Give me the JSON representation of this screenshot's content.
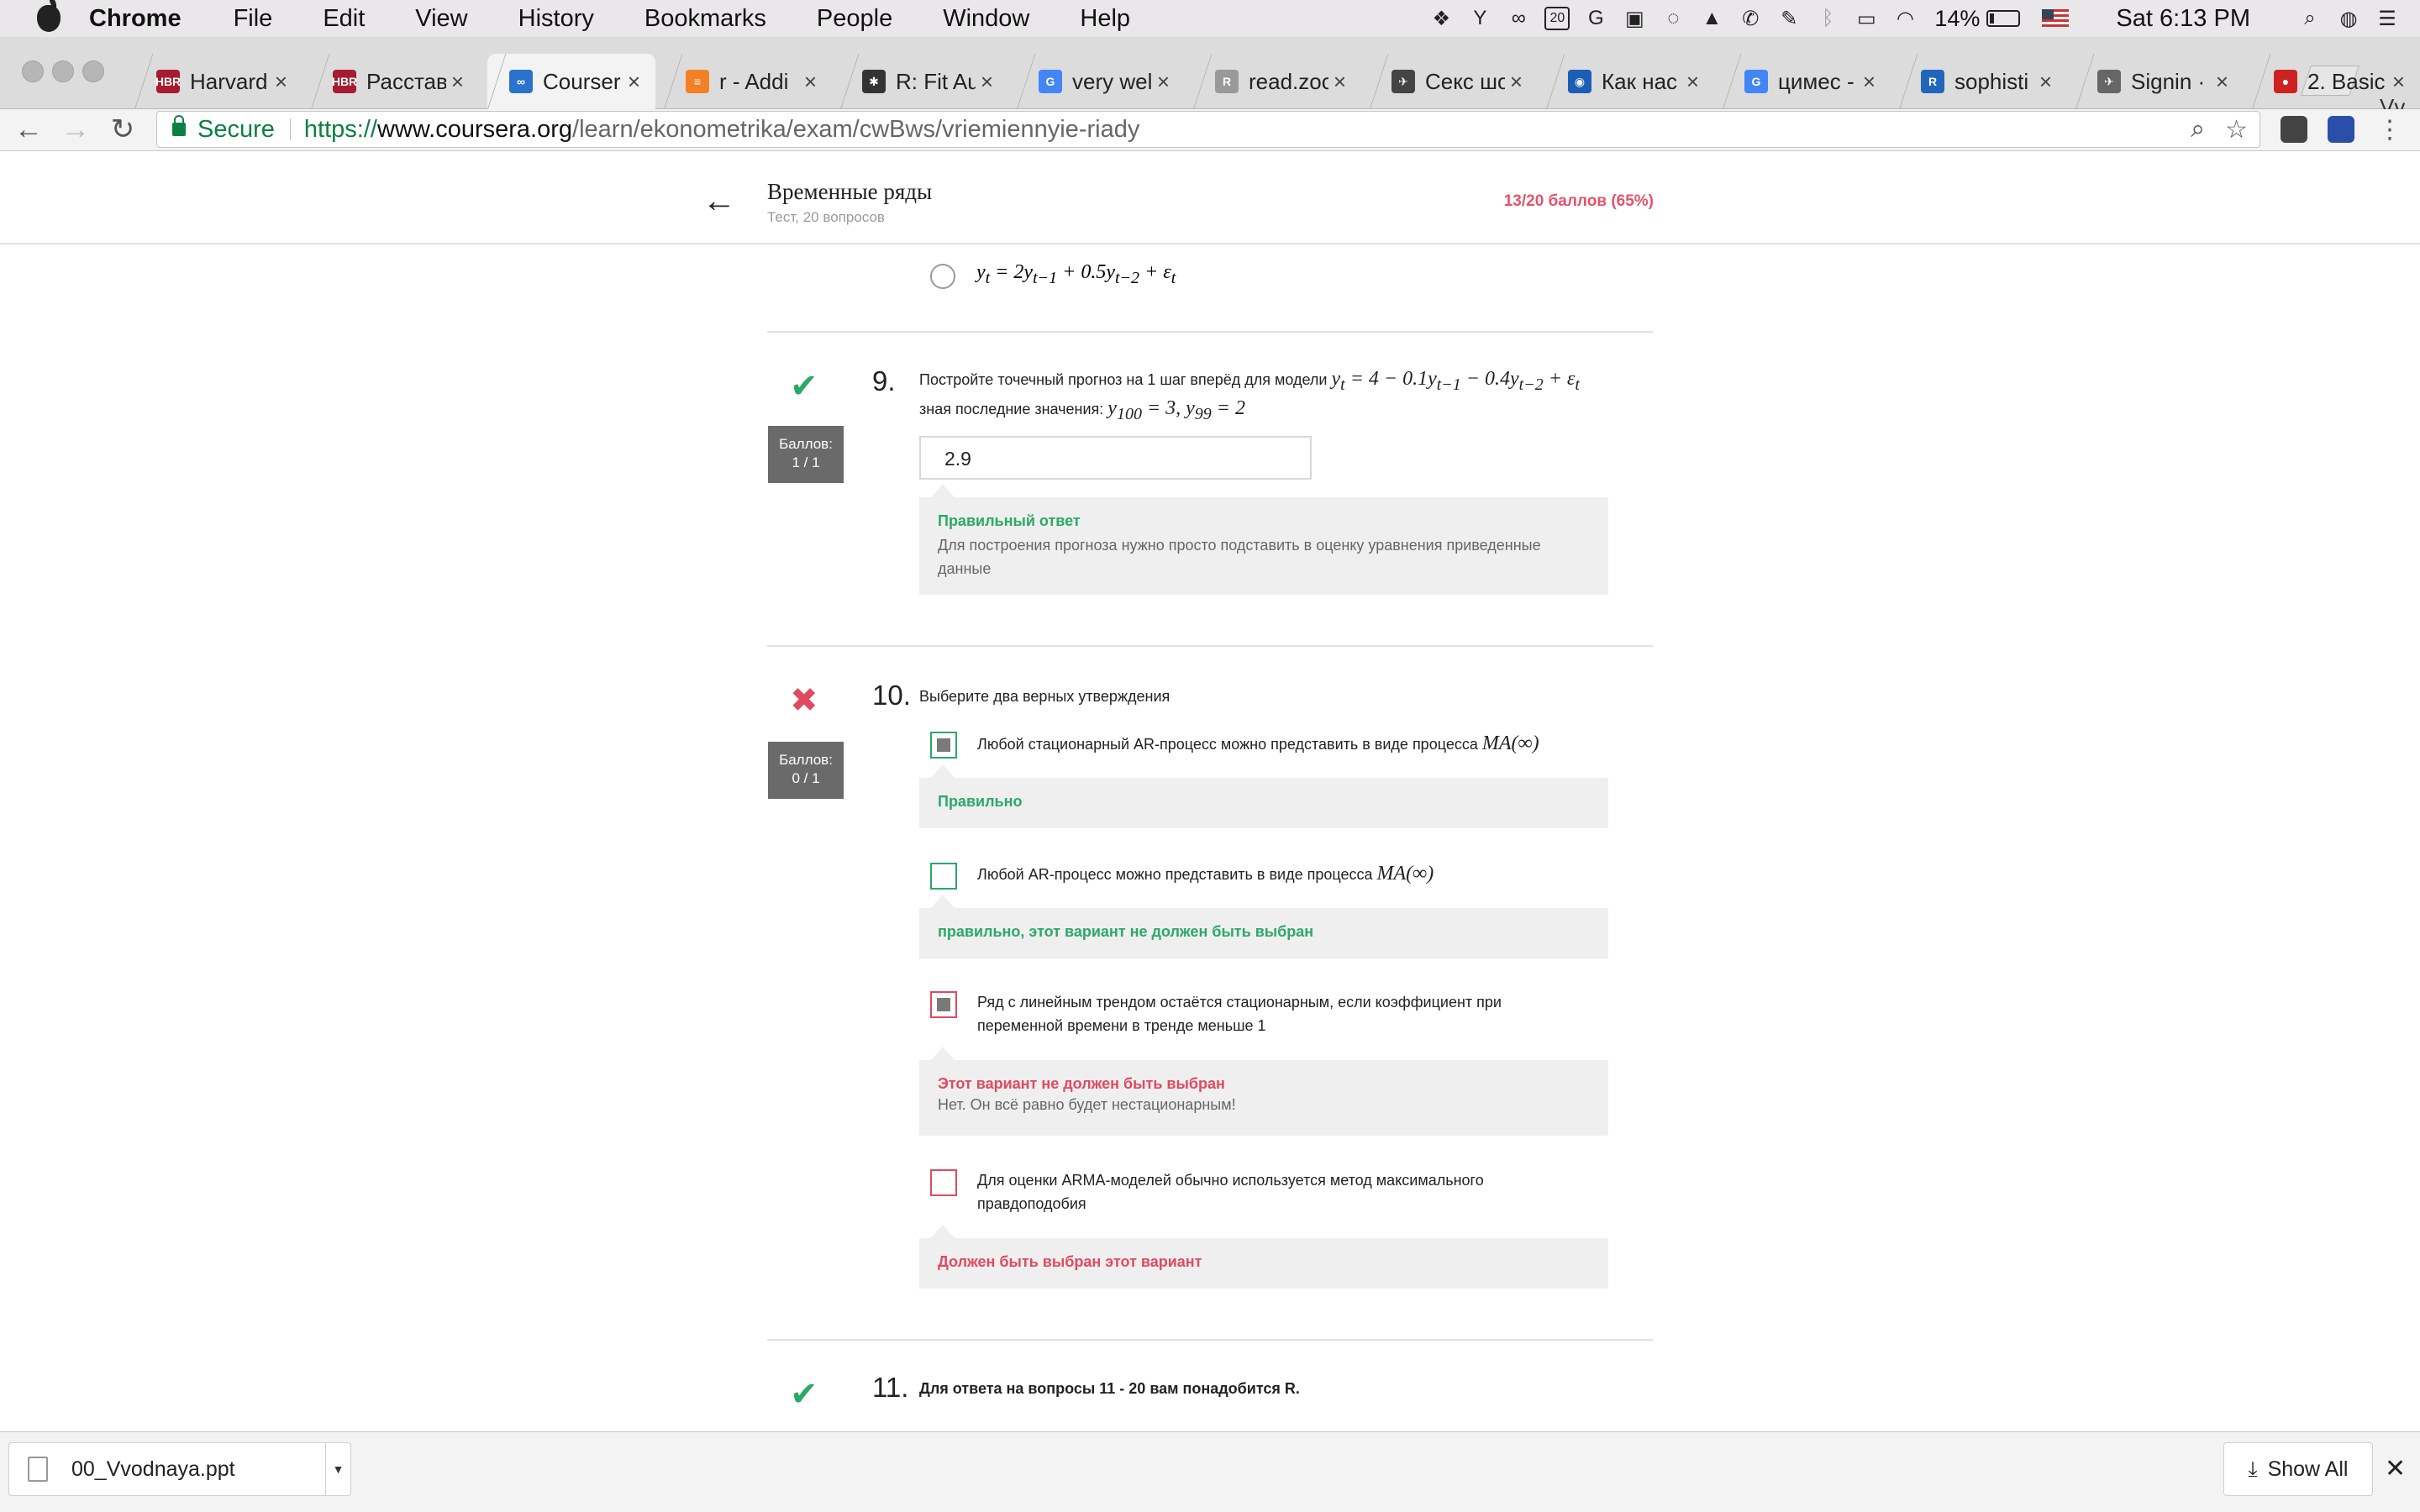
{
  "menubar": {
    "app": "Chrome",
    "items": [
      "File",
      "Edit",
      "View",
      "History",
      "Bookmarks",
      "People",
      "Window",
      "Help"
    ],
    "calendar_day": "20",
    "battery": "14%",
    "clock": "Sat 6:13 PM"
  },
  "tabs": [
    {
      "title": "Harvard",
      "favicon": "hbr-icon",
      "color": "#a51c30",
      "glyph": "HBR"
    },
    {
      "title": "Расстав",
      "favicon": "hbr-icon",
      "color": "#a51c30",
      "glyph": "HBR"
    },
    {
      "title": "Courser",
      "favicon": "coursera-icon",
      "color": "#2a73cc",
      "glyph": "∞",
      "active": true
    },
    {
      "title": "r - Addi",
      "favicon": "stackoverflow-icon",
      "color": "#f48024",
      "glyph": "≡"
    },
    {
      "title": "R: Fit Au",
      "favicon": "r-docs-icon",
      "color": "#333333",
      "glyph": "✱"
    },
    {
      "title": "very wel",
      "favicon": "google-icon",
      "color": "#4285f4",
      "glyph": "G"
    },
    {
      "title": "read.zoo",
      "favicon": "r-docs-icon",
      "color": "#999999",
      "glyph": "R"
    },
    {
      "title": "Секс шо",
      "favicon": "bird-icon",
      "color": "#444444",
      "glyph": "✈"
    },
    {
      "title": "Как нас",
      "favicon": "opera-icon",
      "color": "#1a5fb4",
      "glyph": "◉"
    },
    {
      "title": "цимес -",
      "favicon": "google-icon",
      "color": "#4285f4",
      "glyph": "G"
    },
    {
      "title": "sophisti",
      "favicon": "r-icon",
      "color": "#2266bb",
      "glyph": "R"
    },
    {
      "title": "Signin ·",
      "favicon": "bird-icon",
      "color": "#666666",
      "glyph": "✈"
    },
    {
      "title": "2. Basic",
      "favicon": "pin-icon",
      "color": "#cc2222",
      "glyph": "●"
    }
  ],
  "profile": "Vv",
  "url": {
    "secure_label": "Secure",
    "scheme": "https://",
    "host": "www.coursera.org",
    "path": "/learn/ekonometrika/exam/cwBws/vriemiennyie-riady"
  },
  "header": {
    "title": "Временные ряды",
    "subtitle": "Тест, 20 вопросов",
    "score": "13/20 баллов (65%)"
  },
  "prev_option": {
    "formula_parts": [
      "y",
      "t",
      " = 2y",
      "t−1",
      " + 0.5y",
      "t−2",
      " + ε",
      "t"
    ]
  },
  "q9": {
    "number": "9.",
    "text_before": "Постройте точечный прогноз на 1 шаг вперёд для модели ",
    "formula": [
      "y",
      "t",
      " = 4 − 0.1y",
      "t−1",
      " − 0.4y",
      "t−2",
      " + ε",
      "t"
    ],
    "text_line2": "зная последние значения: ",
    "formula2": [
      "y",
      "100",
      " = 3,  y",
      "99",
      " = 2"
    ],
    "points_label": "Баллов:",
    "points_value": "1 / 1",
    "answer": "2.9",
    "feedback_title": "Правильный ответ",
    "feedback_body": "Для построения прогноза нужно просто подставить в оценку уравнения приведенные данные"
  },
  "q10": {
    "number": "10.",
    "text": "Выберите два верных утверждения",
    "points_label": "Баллов:",
    "points_value": "0 / 1",
    "options": [
      {
        "text": "Любой стационарный AR-процесс можно представить в виде процесса ",
        "math": "MA(∞)",
        "feedback_title": "Правильно",
        "feedback_body": ""
      },
      {
        "text": "Любой AR-процесс можно представить в виде процесса ",
        "math": "MA(∞)",
        "feedback_title": "правильно, этот вариант не должен быть выбран",
        "feedback_body": ""
      },
      {
        "text": "Ряд с линейным трендом остаётся стационарным, если коэффициент при переменной времени в тренде меньше 1",
        "math": "",
        "feedback_title": "Этот вариант не должен быть выбран",
        "feedback_body": "Нет. Он всё равно будет нестационарным!"
      },
      {
        "text": "Для оценки ARMA-моделей обычно используется метод максимального правдоподобия",
        "math": "",
        "feedback_title": "Должен быть выбран этот вариант",
        "feedback_body": ""
      }
    ]
  },
  "q11": {
    "number": "11.",
    "text": "Для ответа на вопросы 11 - 20 вам понадобится R."
  },
  "downloads": {
    "file": "00_Vvodnaya.ppt",
    "show_all": "Show All"
  }
}
